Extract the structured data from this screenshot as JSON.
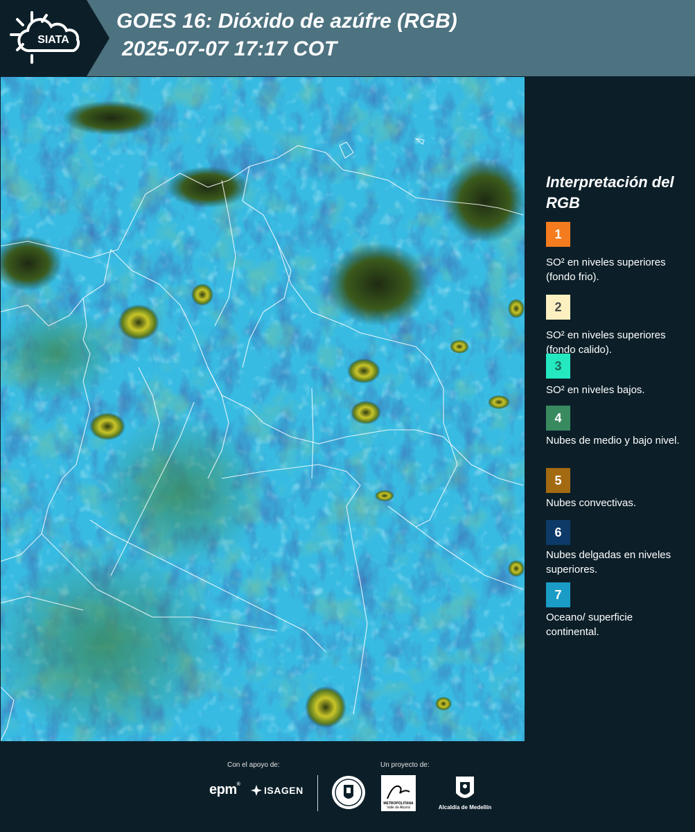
{
  "header": {
    "logo_text": "SIATA",
    "title_line1": "GOES 16: Dióxido de azúfre (RGB)",
    "title_line2": "2025-07-07 17:17 COT"
  },
  "legend": {
    "title": "Interpretación del RGB",
    "items": [
      {
        "number": "1",
        "text": "SO² en niveles superiores (fondo frio).",
        "color": "#f47c1e",
        "text_color": "#ffffff"
      },
      {
        "number": "2",
        "text": "SO² en niveles superiores (fondo calido).",
        "color": "#fcf0c1",
        "text_color": "#4a4a4a"
      },
      {
        "number": "3",
        "text": "SO² en niveles bajos.",
        "color": "#23e8c0",
        "text_color": "#176a5a"
      },
      {
        "number": "4",
        "text": "Nubes de medio y bajo nivel.",
        "color": "#3a8a5f",
        "text_color": "#ffffff"
      },
      {
        "number": "5",
        "text": "Nubes convectivas.",
        "color": "#a36a11",
        "text_color": "#ffffff"
      },
      {
        "number": "6",
        "text": "Nubes delgadas en niveles superiores.",
        "color": "#0d3a68",
        "text_color": "#ffffff"
      },
      {
        "number": "7",
        "text": "Oceano/ superficie continental.",
        "color": "#1a9cc7",
        "text_color": "#ffffff"
      }
    ]
  },
  "footer": {
    "support_label": "Con el apoyo de:",
    "project_label": "Un proyecto de:",
    "sponsor1": "epm",
    "sponsor2": "ISAGEN",
    "partner_area_line1": "METROPOLITANA",
    "partner_area_line2": "Valle de Aburrá",
    "partner_alcaldia": "Alcaldía de Medellín"
  }
}
